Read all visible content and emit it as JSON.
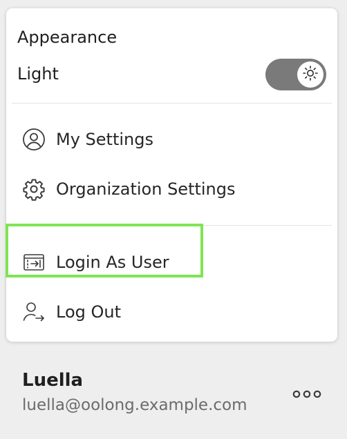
{
  "menu": {
    "appearance": {
      "title": "Appearance",
      "theme_label": "Light",
      "toggle_icon": "sun-icon"
    },
    "items": [
      {
        "label": "My Settings",
        "icon": "user-circle-icon"
      },
      {
        "label": "Organization Settings",
        "icon": "gear-icon"
      },
      {
        "label": "Login As User",
        "icon": "login-as-user-icon"
      },
      {
        "label": "Log Out",
        "icon": "log-out-icon"
      }
    ],
    "highlight_color": "#7ee552"
  },
  "user": {
    "name": "Luella",
    "email": "luella@oolong.example.com",
    "more_icon": "more-horizontal-icon"
  },
  "colors": {
    "toggle_track": "#7a7a7a",
    "background": "#eeeeee"
  }
}
